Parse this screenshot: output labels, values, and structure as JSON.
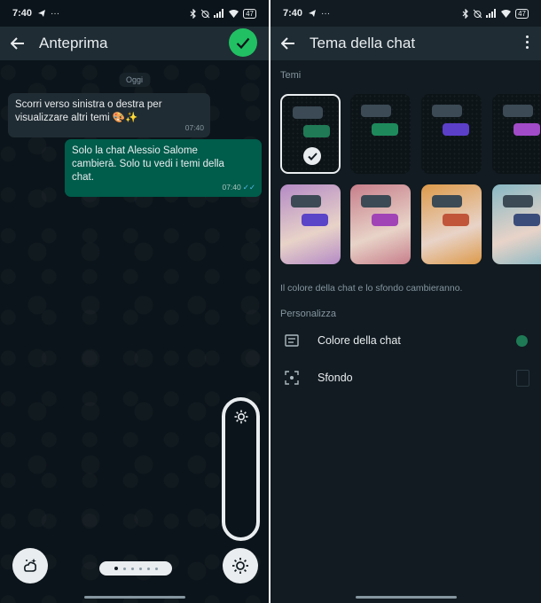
{
  "left": {
    "status": {
      "time": "7:40",
      "battery": "47"
    },
    "title": "Anteprima",
    "date_chip": "Oggi",
    "msg_in": {
      "text": "Scorri verso sinistra o destra per visualizzare altri temi 🎨✨",
      "time": "07:40"
    },
    "msg_out": {
      "text": "Solo la chat Alessio Salome cambierà. Solo tu vedi i temi della chat.",
      "time": "07:40"
    },
    "icons": [
      "back-arrow-icon",
      "check-icon",
      "brightness-icon",
      "doodle-icon",
      "sun-icon"
    ],
    "page_indicator": {
      "count": 6,
      "active": 0
    }
  },
  "right": {
    "status": {
      "time": "7:40",
      "battery": "47"
    },
    "title": "Tema della chat",
    "themes_label": "Temi",
    "themes": [
      {
        "bubble": "#1f7a55",
        "bg": "dark",
        "selected": true
      },
      {
        "bubble": "#1e8a5c",
        "bg": "dark"
      },
      {
        "bubble": "#5b3fc9",
        "bg": "dark"
      },
      {
        "bubble": "#a14bc8",
        "bg": "dark"
      },
      {
        "bubble": "#5a44c7",
        "bg": "#b48ac6"
      },
      {
        "bubble": "#a044b6",
        "bg": "#c77e8a"
      },
      {
        "bubble": "#c0553a",
        "bg": "#dd9a4a"
      },
      {
        "bubble": "#3a4c7a",
        "bg": "#88b8c4"
      }
    ],
    "info": "Il colore della chat e lo sfondo cambieranno.",
    "personalize_label": "Personalizza",
    "chat_color_label": "Colore della chat",
    "chat_color_value": "#1e7a55",
    "wallpaper_label": "Sfondo"
  }
}
